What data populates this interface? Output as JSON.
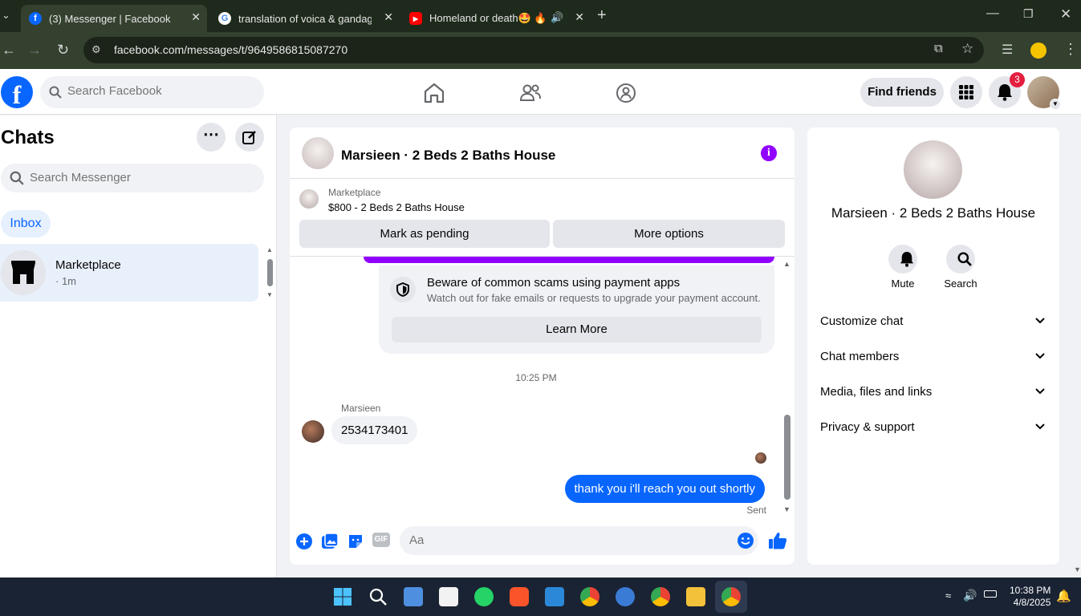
{
  "browser": {
    "tabs": [
      {
        "title": "(3) Messenger | Facebook",
        "favicon": "facebook-icon",
        "active": true
      },
      {
        "title": "translation of voica & gandaga",
        "favicon": "google-icon",
        "active": false
      },
      {
        "title": "Homeland or death🤩 🔥 .G",
        "favicon": "youtube-icon",
        "active": false
      }
    ],
    "url": "facebook.com/messages/t/9649586815087270"
  },
  "fb": {
    "search_placeholder": "Search Facebook",
    "find_friends": "Find friends",
    "notification_count": "3"
  },
  "chats": {
    "title": "Chats",
    "search_placeholder": "Search Messenger",
    "inbox": "Inbox",
    "items": [
      {
        "name": "Marketplace",
        "time": "· 1m"
      }
    ]
  },
  "conversation": {
    "title": "Marsieen · 2 Beds 2 Baths House",
    "marketplace_label": "Marketplace",
    "listing": "$800 - 2 Beds 2 Baths House",
    "mark_pending": "Mark as pending",
    "more_options": "More options",
    "scam_title": "Beware of common scams using payment apps",
    "scam_desc": "Watch out for fake emails or requests to upgrade your payment account.",
    "learn_more": "Learn More",
    "timestamp": "10:25 PM",
    "sender_name": "Marsieen",
    "incoming_message": "2534173401",
    "outgoing_message": "thank you i'll reach you out shortly",
    "sent_label": "Sent",
    "composer_placeholder": "Aa"
  },
  "details": {
    "title": "Marsieen · 2 Beds 2 Baths House",
    "mute": "Mute",
    "search": "Search",
    "sections": [
      "Customize chat",
      "Chat members",
      "Media, files and links",
      "Privacy & support"
    ]
  },
  "taskbar": {
    "time": "10:38 PM",
    "date": "4/8/2025"
  },
  "colors": {
    "brand": "#0866ff",
    "accent_purple": "#9100ff",
    "badge_red": "#e41e3f"
  }
}
